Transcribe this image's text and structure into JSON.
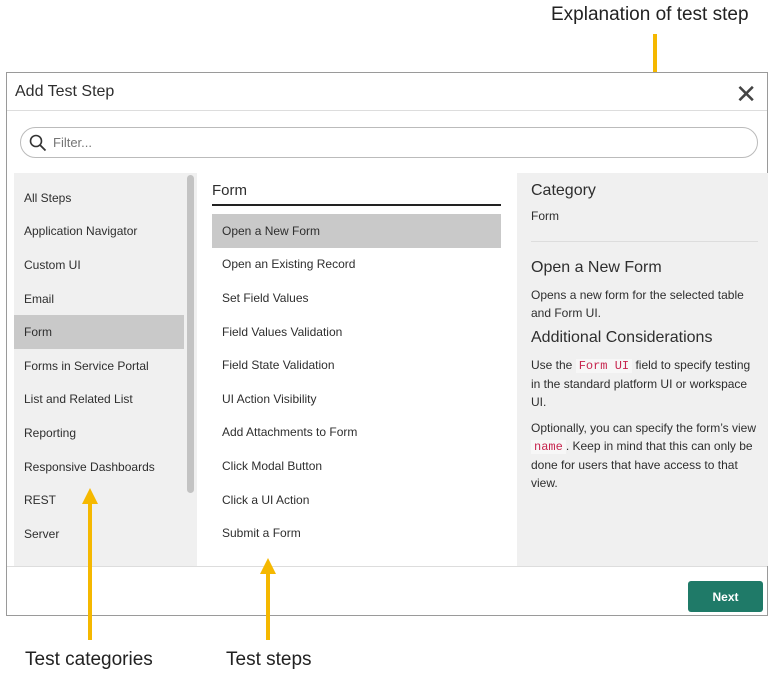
{
  "annotations": {
    "explanation": "Explanation of test step",
    "categories": "Test categories",
    "steps": "Test steps",
    "arrow_color": "#f5b800"
  },
  "dialog": {
    "title": "Add Test Step",
    "filter_placeholder": "Filter...",
    "next_label": "Next",
    "accent": "#1f7a68"
  },
  "categories": [
    "All Steps",
    "Application Navigator",
    "Custom UI",
    "Email",
    "Form",
    "Forms in Service Portal",
    "List and Related List",
    "Reporting",
    "Responsive Dashboards",
    "REST",
    "Server"
  ],
  "selected_category": "Form",
  "steps_header": "Form",
  "steps": [
    "Open a New Form",
    "Open an Existing Record",
    "Set Field Values",
    "Field Values Validation",
    "Field State Validation",
    "UI Action Visibility",
    "Add Attachments to Form",
    "Click Modal Button",
    "Click a UI Action",
    "Submit a Form"
  ],
  "detail": {
    "category_label": "Category",
    "category_value": "Form",
    "step_title": "Open a New Form",
    "description": "Opens a new form for the selected table and Form UI.",
    "considerations_title": "Additional Considerations",
    "p1_a": "Use the ",
    "p1_code": "Form UI",
    "p1_b": " field to specify testing in the standard platform UI or workspace UI.",
    "p2_a": "Optionally, you can specify the form’s view ",
    "p2_code": "name",
    "p2_b": ". Keep in mind that this can only be done for users that have access to that view."
  }
}
